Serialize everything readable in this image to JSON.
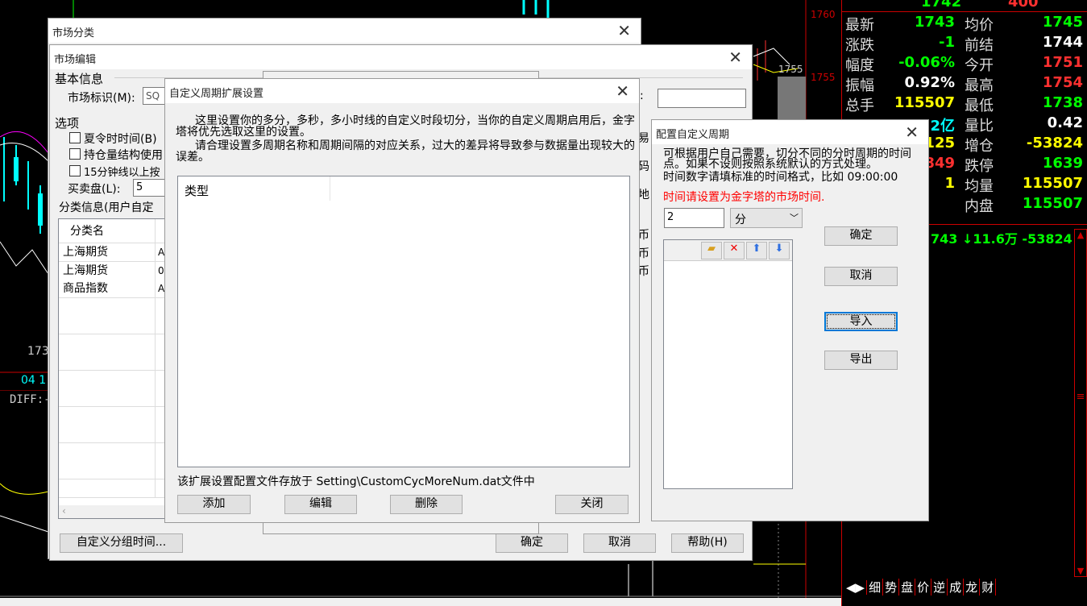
{
  "quote_panel": {
    "top_values": [
      "1742",
      "400"
    ],
    "rows": [
      {
        "l1": "最新",
        "v1": "1743",
        "c1": "g",
        "l2": "均价",
        "v2": "1745",
        "c2": "g"
      },
      {
        "l1": "涨跌",
        "v1": "-1",
        "c1": "g",
        "l2": "前结",
        "v2": "1744",
        "c2": "w"
      },
      {
        "l1": "幅度",
        "v1": "-0.06%",
        "c1": "g",
        "l2": "今开",
        "v2": "1751",
        "c2": "r"
      },
      {
        "l1": "振幅",
        "v1": "0.92%",
        "c1": "w",
        "l2": "最高",
        "v2": "1754",
        "c2": "r"
      },
      {
        "l1": "总手",
        "v1": "115507",
        "c1": "y",
        "l2": "最低",
        "v2": "1738",
        "c2": "g"
      },
      {
        "l1": "",
        "v1": "2亿",
        "c1": "c",
        "l2": "量比",
        "v2": "0.42",
        "c2": "w"
      },
      {
        "l1": "",
        "v1": "125",
        "c1": "y",
        "l2": "增仓",
        "v2": "-53824",
        "c2": "y"
      },
      {
        "l1": "",
        "v1": "849",
        "c1": "r",
        "l2": "跌停",
        "v2": "1639",
        "c2": "g"
      },
      {
        "l1": "",
        "v1": "1",
        "c1": "y",
        "l2": "均量",
        "v2": "115507",
        "c2": "y"
      },
      {
        "l1": "",
        "v1": "",
        "c1": "w",
        "l2": "内盘",
        "v2": "115507",
        "c2": "g"
      }
    ],
    "tick_line": "743 ↓11.6万 -53824",
    "price_labels": [
      "1760",
      "1755",
      "1755"
    ],
    "tabs": [
      "细",
      "势",
      "盘",
      "价",
      "逆",
      "成",
      "龙",
      "财"
    ]
  },
  "chart_labels": {
    "price": "173",
    "date": "04 1",
    "diff": "DIFF:-"
  },
  "market_category": {
    "title": "市场分类"
  },
  "market_edit": {
    "title": "市场编辑",
    "basic_info": "基本信息",
    "market_id_label": "市场标识(M):",
    "market_id_value": "SQ",
    "options": "选项",
    "opt_dst": "夏令时时间(B)",
    "opt_position": "持仓量结构使用",
    "opt_15min": "15分钟线以上按",
    "bid_ask_label": "买卖盘(L):",
    "bid_ask_value": "5",
    "category_info": "分类信息(用户自定",
    "col_name": "分类名",
    "rows": [
      {
        "name": "上海期货",
        "code": "A"
      },
      {
        "name": "上海期货",
        "code": "0"
      },
      {
        "name": "商品指数",
        "code": "A"
      }
    ],
    "right_snippets": [
      "易",
      "码",
      "地",
      "币",
      "币",
      "币"
    ],
    "btn_group_time": "自定义分组时间...",
    "btn_ok": "确定",
    "btn_cancel": "取消",
    "btn_help": "帮助(H)"
  },
  "custom_ext": {
    "title": "自定义周期扩展设置",
    "desc1": "这里设置你的多分，多秒，多小时线的自定义时段切分，当你的自定义周期启用后，金字塔将优先选取这里的设置。",
    "desc2": "请合理设置多周期名称和周期间隔的对应关系，过大的差异将导致参与数据量出现较大的误差。",
    "col_type": "类型",
    "footer": "该扩展设置配置文件存放于 Setting\\CustomCycMoreNum.dat文件中",
    "btn_add": "添加",
    "btn_edit": "编辑",
    "btn_delete": "删除",
    "btn_close": "关闭"
  },
  "config_cycle": {
    "title": "配置自定义周期",
    "desc1": "可根据用户自己需要，切分不同的分时周期的时间点。如果不设则按照系统默认的方式处理。",
    "desc2": "时间数字请填标准的时间格式，比如 09:00:00",
    "warn": "时间请设置为金字塔的市场时间.",
    "num_value": "2",
    "unit_value": "分",
    "btn_ok": "确定",
    "btn_cancel": "取消",
    "btn_import": "导入",
    "btn_export": "导出"
  }
}
